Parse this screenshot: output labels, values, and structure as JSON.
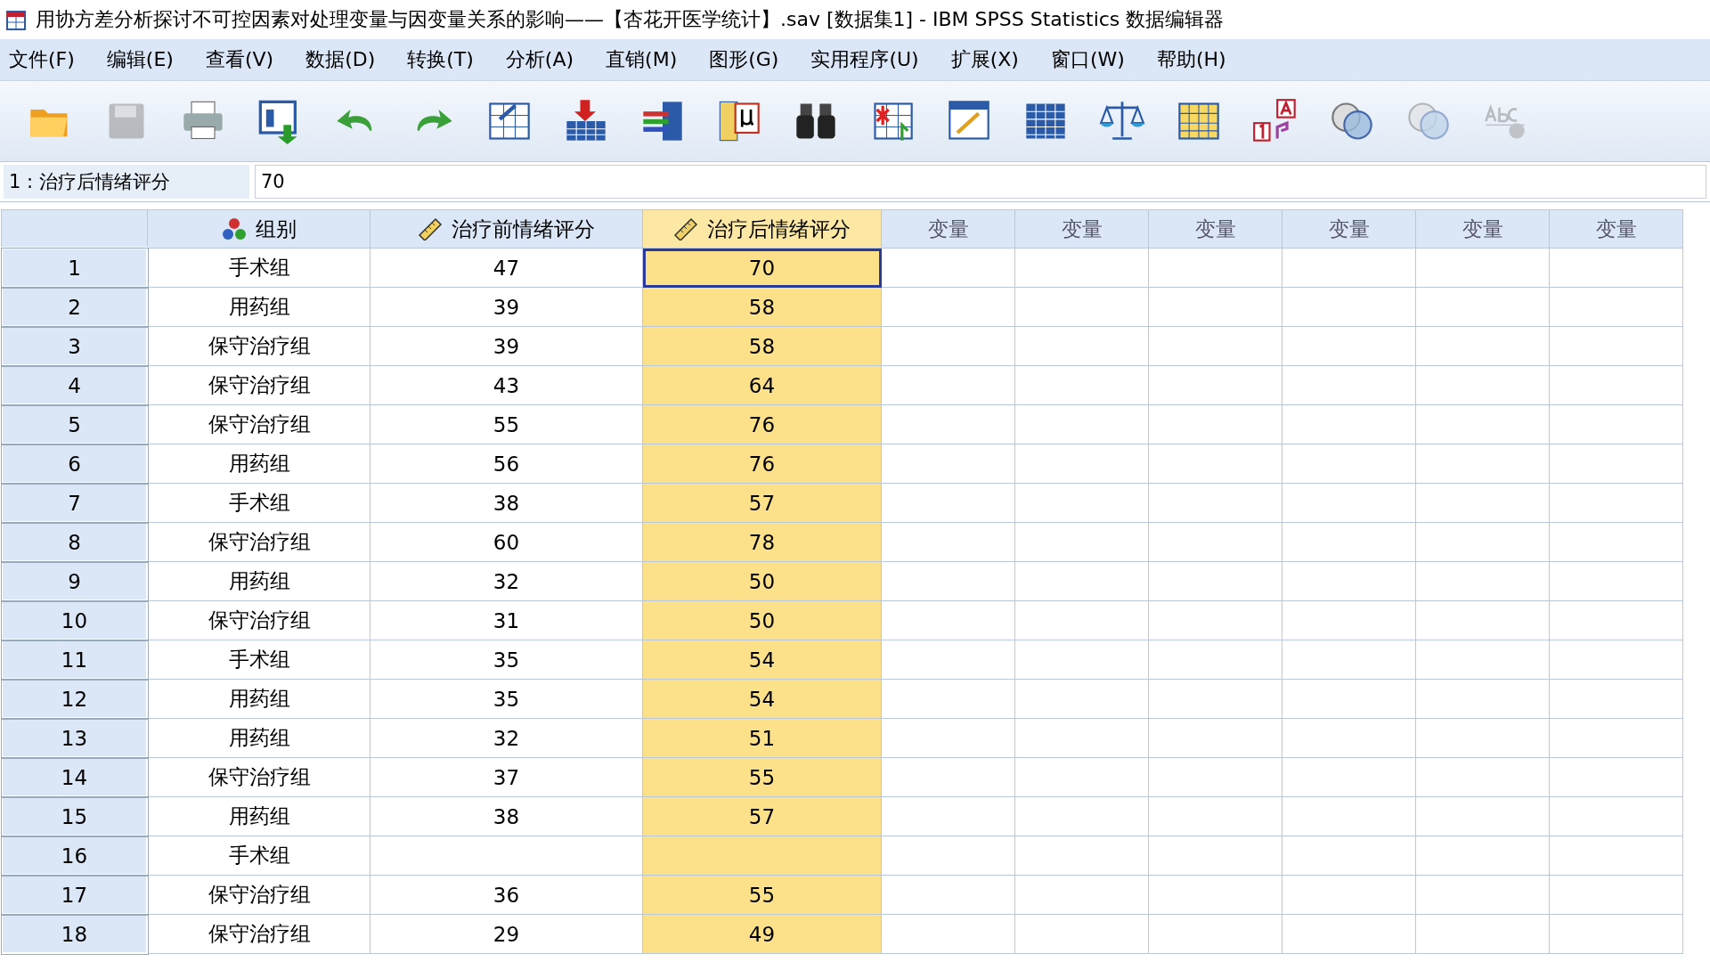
{
  "window": {
    "title": "用协方差分析探讨不可控因素对处理变量与因变量关系的影响——【杏花开医学统计】.sav [数据集1] - IBM SPSS Statistics 数据编辑器"
  },
  "menu": [
    "文件(F)",
    "编辑(E)",
    "查看(V)",
    "数据(D)",
    "转换(T)",
    "分析(A)",
    "直销(M)",
    "图形(G)",
    "实用程序(U)",
    "扩展(X)",
    "窗口(W)",
    "帮助(H)"
  ],
  "toolbar": [
    {
      "kind": "open",
      "disabled": false
    },
    {
      "kind": "save",
      "disabled": true
    },
    {
      "kind": "print",
      "disabled": false
    },
    {
      "kind": "recall",
      "disabled": false
    },
    {
      "kind": "undo",
      "disabled": false
    },
    {
      "kind": "redo",
      "disabled": false
    },
    {
      "kind": "goto-case",
      "disabled": false
    },
    {
      "kind": "insert-case",
      "disabled": false
    },
    {
      "kind": "variables",
      "disabled": false
    },
    {
      "kind": "descriptives",
      "disabled": false
    },
    {
      "kind": "find",
      "disabled": false
    },
    {
      "kind": "insert-var",
      "disabled": false
    },
    {
      "kind": "split",
      "disabled": false
    },
    {
      "kind": "table",
      "disabled": false
    },
    {
      "kind": "weight",
      "disabled": false
    },
    {
      "kind": "select",
      "disabled": false
    },
    {
      "kind": "labels",
      "disabled": false
    },
    {
      "kind": "sets",
      "disabled": false
    },
    {
      "kind": "sets",
      "disabled": true
    },
    {
      "kind": "spell",
      "disabled": true
    }
  ],
  "cell_editor": {
    "label": "1 : 治疗后情绪评分",
    "value": "70"
  },
  "columns": [
    {
      "name": "组别",
      "kind": "nominal",
      "selected": false
    },
    {
      "name": "治疗前情绪评分",
      "kind": "scale",
      "selected": false
    },
    {
      "name": "治疗后情绪评分",
      "kind": "scale",
      "selected": true
    },
    {
      "name": "变量",
      "kind": "empty",
      "selected": false
    },
    {
      "name": "变量",
      "kind": "empty",
      "selected": false
    },
    {
      "name": "变量",
      "kind": "empty",
      "selected": false
    },
    {
      "name": "变量",
      "kind": "empty",
      "selected": false
    },
    {
      "name": "变量",
      "kind": "empty",
      "selected": false
    },
    {
      "name": "变量",
      "kind": "empty",
      "selected": false
    }
  ],
  "rows": [
    {
      "number": "1",
      "active": true,
      "cells": [
        "手术组",
        "47",
        "70"
      ]
    },
    {
      "number": "2",
      "active": false,
      "cells": [
        "用药组",
        "39",
        "58"
      ]
    },
    {
      "number": "3",
      "active": false,
      "cells": [
        "保守治疗组",
        "39",
        "58"
      ]
    },
    {
      "number": "4",
      "active": false,
      "cells": [
        "保守治疗组",
        "43",
        "64"
      ]
    },
    {
      "number": "5",
      "active": false,
      "cells": [
        "保守治疗组",
        "55",
        "76"
      ]
    },
    {
      "number": "6",
      "active": false,
      "cells": [
        "用药组",
        "56",
        "76"
      ]
    },
    {
      "number": "7",
      "active": false,
      "cells": [
        "手术组",
        "38",
        "57"
      ]
    },
    {
      "number": "8",
      "active": false,
      "cells": [
        "保守治疗组",
        "60",
        "78"
      ]
    },
    {
      "number": "9",
      "active": false,
      "cells": [
        "用药组",
        "32",
        "50"
      ]
    },
    {
      "number": "10",
      "active": false,
      "cells": [
        "保守治疗组",
        "31",
        "50"
      ]
    },
    {
      "number": "11",
      "active": false,
      "cells": [
        "手术组",
        "35",
        "54"
      ]
    },
    {
      "number": "12",
      "active": false,
      "cells": [
        "用药组",
        "35",
        "54"
      ]
    },
    {
      "number": "13",
      "active": false,
      "cells": [
        "用药组",
        "32",
        "51"
      ]
    },
    {
      "number": "14",
      "active": false,
      "cells": [
        "保守治疗组",
        "37",
        "55"
      ]
    },
    {
      "number": "15",
      "active": false,
      "cells": [
        "用药组",
        "38",
        "57"
      ]
    },
    {
      "number": "16",
      "active": false,
      "cells": [
        "手术组"
      ]
    },
    {
      "number": "17",
      "active": false,
      "cells": [
        "保守治疗组",
        "36",
        "55"
      ]
    },
    {
      "number": "18",
      "active": false,
      "cells": [
        "保守治疗组",
        "29",
        "49"
      ]
    }
  ]
}
